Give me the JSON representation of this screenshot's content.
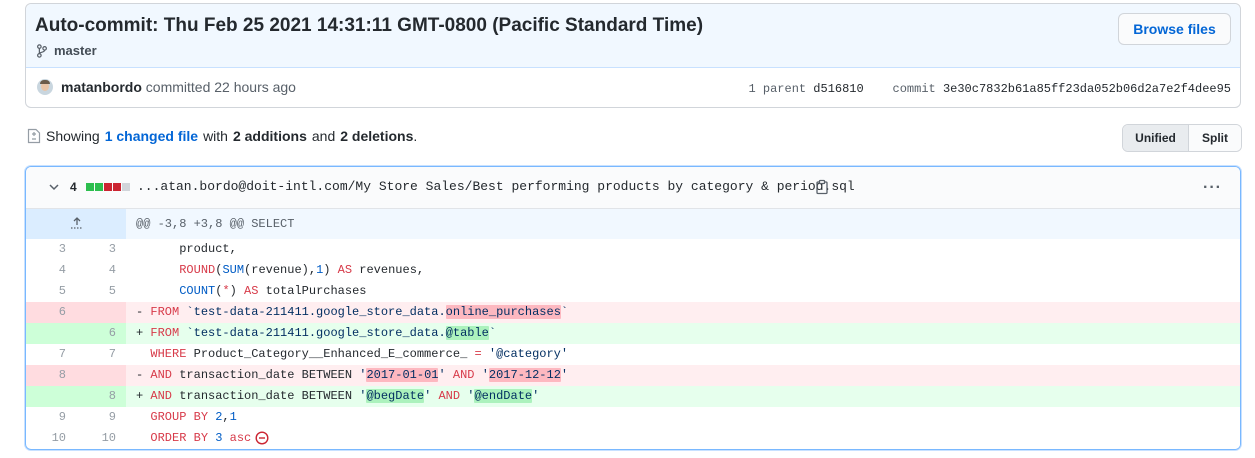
{
  "commit": {
    "title": "Auto-commit: Thu Feb 25 2021 14:31:11 GMT-0800 (Pacific Standard Time)",
    "branch": "master",
    "browse_button": "Browse files",
    "author": "matanbordo",
    "committed_text": " committed 22 hours ago",
    "parent_label": "1 parent",
    "parent_sha": "d516810",
    "commit_label": "commit",
    "commit_sha": "3e30c7832b61a85ff23da052b06d2a7e2f4dee95"
  },
  "summary": {
    "showing": "Showing",
    "changed_files": "1 changed file",
    "with": "with",
    "additions": "2 additions",
    "and": "and",
    "deletions": "2 deletions",
    "period": "."
  },
  "view_toggle": {
    "unified": "Unified",
    "split": "Split",
    "selected": "Unified"
  },
  "file": {
    "change_count": "4",
    "diffstat": [
      "add",
      "add",
      "del",
      "del",
      "neutral"
    ],
    "path": "...atan.bordo@doit-intl.com/My Store Sales/Best performing products by category & period.sql",
    "menu": "···",
    "hunk_header": "@@ -3,8 +3,8 @@ SELECT",
    "lines": [
      {
        "type": "ctx",
        "old": "3",
        "new": "3"
      },
      {
        "type": "ctx",
        "old": "4",
        "new": "4"
      },
      {
        "type": "ctx",
        "old": "5",
        "new": "5"
      },
      {
        "type": "del",
        "old": "6",
        "new": ""
      },
      {
        "type": "add",
        "old": "",
        "new": "6"
      },
      {
        "type": "ctx",
        "old": "7",
        "new": "7"
      },
      {
        "type": "del",
        "old": "8",
        "new": ""
      },
      {
        "type": "add",
        "old": "",
        "new": "8"
      },
      {
        "type": "ctx",
        "old": "9",
        "new": "9"
      },
      {
        "type": "ctx",
        "old": "10",
        "new": "10"
      }
    ],
    "code": {
      "l3": {
        "text": "      product,"
      },
      "l4": {
        "indent": "      ",
        "round": "ROUND",
        "open": "(",
        "sum": "SUM",
        "mid": "(revenue),",
        "one": "1",
        "close": ") ",
        "as": "AS",
        "rest": " revenues,"
      },
      "l5": {
        "indent": "      ",
        "count": "COUNT",
        "open": "(",
        "star": "*",
        "close": ") ",
        "as": "AS",
        "rest": " totalPurchases"
      },
      "l6": {
        "sign": "- ",
        "from": "FROM",
        "pre": " `test-data-211411.google_store_data.",
        "hl": "online_purchases",
        "post": "`"
      },
      "l6n": {
        "sign": "+ ",
        "from": "FROM",
        "pre": " `test-data-211411.google_store_data.",
        "hl": "@table",
        "post": "`"
      },
      "l7": {
        "indent": "  ",
        "where": "WHERE",
        "mid": " Product_Category__Enhanced_E_commerce_ ",
        "eq": "=",
        "sp": " ",
        "str": "'@category'"
      },
      "l8": {
        "sign": "- ",
        "and": "AND",
        "mid": " transaction_date BETWEEN ",
        "q1": "'",
        "hl1": "2017-01-01",
        "q2": "'",
        "sp": " ",
        "and2": "AND",
        "sp2": " ",
        "q3": "'",
        "hl2": "2017-12-12",
        "q4": "'"
      },
      "l8n": {
        "sign": "+ ",
        "and": "AND",
        "mid": " transaction_date BETWEEN ",
        "q1": "'",
        "hl1": "@begDate",
        "q2": "'",
        "sp": " ",
        "and2": "AND",
        "sp2": " ",
        "q3": "'",
        "hl2": "@endDate",
        "q4": "'"
      },
      "l9": {
        "indent": "  ",
        "group": "GROUP BY",
        "sp": " ",
        "n1": "2",
        "comma": ",",
        "n2": "1"
      },
      "l10": {
        "indent": "  ",
        "order": "ORDER BY",
        "sp": " ",
        "n": "3",
        "sp2": " ",
        "asc": "asc"
      }
    }
  },
  "colors": {
    "accent": "#0366d6",
    "add_bg": "#e6ffed",
    "del_bg": "#ffeef0",
    "add_highlight": "#acf2bd",
    "del_highlight": "#fdb8c0",
    "keyword": "#d73a49"
  },
  "icons": {
    "branch": "git-branch-icon",
    "file": "file-diff-icon",
    "chevron": "chevron-down-icon",
    "copy": "clipboard-icon",
    "expand": "unfold-icon",
    "no_newline": "no-entry-icon"
  }
}
